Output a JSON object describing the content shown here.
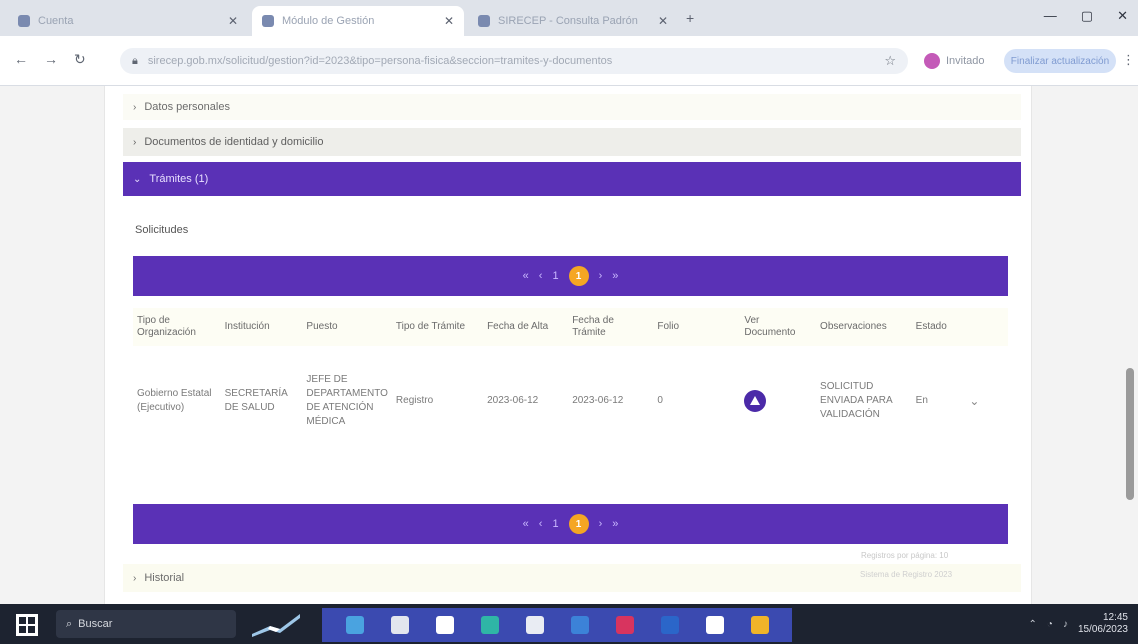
{
  "browser": {
    "tabs": [
      {
        "title": "Cuenta",
        "active": false
      },
      {
        "title": "Módulo de Gestión",
        "active": true
      },
      {
        "title": "SIRECEP - Consulta Padrón",
        "active": false
      }
    ],
    "new_tab": "+",
    "window_controls": {
      "minimize": "—",
      "maximize": "▢",
      "close": "✕"
    },
    "nav": {
      "back": "←",
      "forward": "→",
      "reload": "↻"
    },
    "url": "sirecep.gob.mx/solicitud/gestion?id=2023&tipo=persona-fisica&seccion=tramites-y-documentos",
    "profile_label": "Invitado",
    "finish_button": "Finalizar actualización",
    "menu": "⋮"
  },
  "page": {
    "accordions": {
      "first": {
        "label": "Datos personales",
        "expanded": false
      },
      "second": {
        "label": "Documentos de identidad y domicilio",
        "expanded": false
      },
      "third": {
        "label": "Trámites (1)",
        "expanded": true
      },
      "last": {
        "label": "Historial",
        "expanded": false
      }
    },
    "section_title": "Solicitudes",
    "pager": {
      "prev_prev": "«",
      "prev": "‹",
      "first": "1",
      "current": "1",
      "next": "›",
      "next_next": "»"
    },
    "table": {
      "headers": [
        "Tipo de Organización",
        "Institución",
        "Puesto",
        "Tipo de Trámite",
        "Fecha de Alta",
        "Fecha de Trámite",
        "Folio",
        "Ver Documento",
        "Observaciones",
        "Estado"
      ],
      "rows": [
        {
          "organizacion": "Gobierno Estatal (Ejecutivo)",
          "institucion": "SECRETARÍA DE SALUD",
          "puesto": "JEFE DE DEPARTAMENTO DE ATENCIÓN MÉDICA",
          "tramite": "Registro",
          "fecha_alta": "2023-06-12",
          "fecha_tramite": "2023-06-12",
          "folio": "0",
          "observaciones": "SOLICITUD ENVIADA PARA VALIDACIÓN",
          "estado": "En"
        }
      ]
    },
    "footer_note": "Registros por página: 10",
    "footer_note2": "Sistema de Registro 2023"
  },
  "taskbar": {
    "search_label": "Buscar",
    "time": "12:45",
    "date": "15/06/2023"
  },
  "colors": {
    "accent": "#5a31b6",
    "pager_current": "#f5a623"
  }
}
